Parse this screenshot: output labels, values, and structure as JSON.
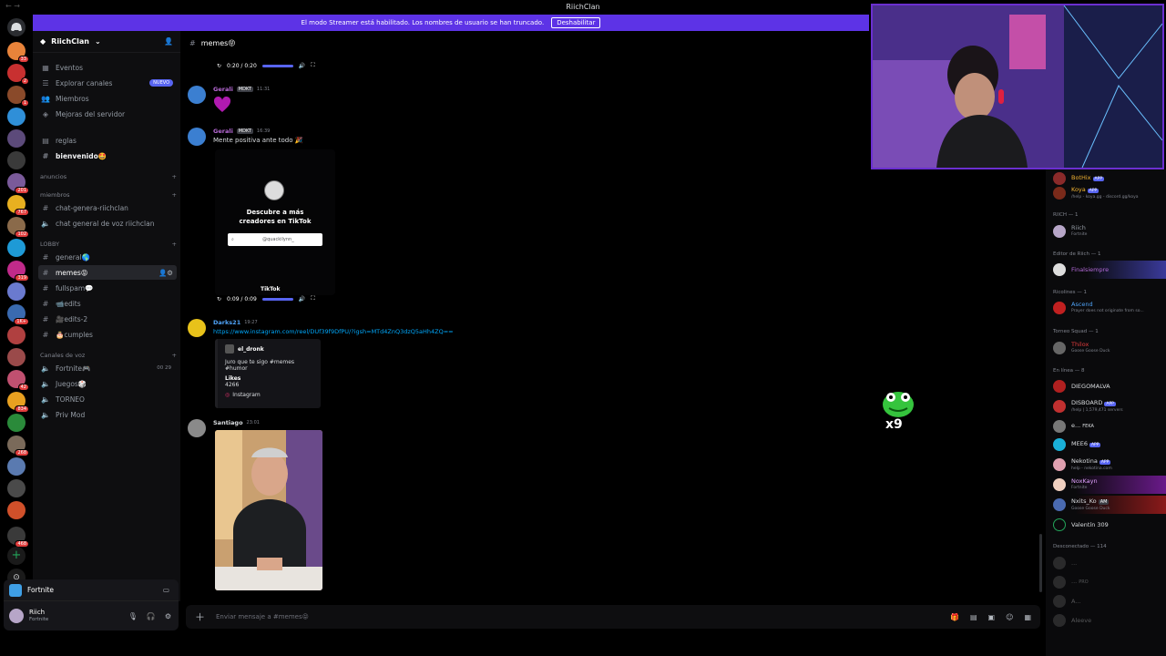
{
  "window": {
    "title": "RiichClan"
  },
  "banner": {
    "text": "El modo Streamer está habilitado. Los nombres de usuario se han truncado.",
    "button": "Deshabilitar"
  },
  "guild_badges": [
    "33",
    "2",
    "1",
    "201",
    "767",
    "102",
    "319",
    "1K+",
    "42",
    "834",
    "268",
    "468"
  ],
  "server": {
    "name": "RiichClan"
  },
  "nav": {
    "eventos": "Eventos",
    "explorar": "Explorar canales",
    "nuevo": "NUEVO",
    "miembros": "Miembros",
    "mejoras": "Mejoras del servidor"
  },
  "channels": {
    "reglas": "reglas",
    "bienvenido": "bienvenido🤩",
    "cat_anuncios": "anuncios",
    "cat_miembros": "miembros",
    "chat_genera": "chat-genera-riichclan",
    "chat_voz": "chat general de voz riichclan",
    "cat_lobby": "LOBBY",
    "general": "general🌎",
    "memes": "memes😝",
    "fullspam": "fullspam💬",
    "edits": "📹edits",
    "edits2": "🎥edits-2",
    "cumples": "🎂cumples",
    "cat_voz": "Canales de voz",
    "fortnite": "Fortnite🎮",
    "fortnite_count": "00  29",
    "juegos": "Juegos🎲",
    "torneo": "TORNEO",
    "priv": "Priv Mod"
  },
  "voice_panel": {
    "channel": "Fortnite"
  },
  "user": {
    "name": "Riich",
    "status": "Fortnite"
  },
  "chat": {
    "channel": "memes😝",
    "player1": {
      "time": "0:20 / 0:20"
    },
    "msg1": {
      "name": "Gerali",
      "badge": "MDKT",
      "time": "11:31"
    },
    "msg2": {
      "name": "Gerali",
      "badge": "MDKT",
      "time": "16:39",
      "text": "Mente positiva  ante todo 🎉"
    },
    "tiktok": {
      "title1": "Descubre a más",
      "title2": "creadores en TikTok",
      "search": "@quackilynn_",
      "logo": "TikTok"
    },
    "player2": {
      "time": "0:09 / 0:09"
    },
    "msg3": {
      "name": "Darks21",
      "time": "19:27",
      "link": "https://www.instagram.com/reel/DUf39f9DfPU/?igsh=MTd4ZnQ3dzQ5aHh4ZQ=="
    },
    "embed": {
      "author": "el_dronk",
      "text": "Juro que te sigo #memes #humor",
      "likes_label": "Likes",
      "likes": "4266",
      "provider": "Instagram"
    },
    "msg4": {
      "name": "Santiago",
      "time": "23:01"
    }
  },
  "composer": {
    "placeholder": "Enviar mensaje a #memes😝"
  },
  "sticker": {
    "count": "x9"
  },
  "members": {
    "bot1": {
      "name": "BotHix",
      "tag": "APP"
    },
    "koya": {
      "name": "Koya",
      "tag": "APP",
      "sub": "/help - koya.gg - discord.gg/koya"
    },
    "g_riich": "RIICH — 1",
    "riich": {
      "name": "Riich",
      "sub": "Fortnite"
    },
    "g_editor": "Editor de Riich — 1",
    "editor": {
      "name": "Finalsiempre"
    },
    "g_ricolines": "Ricolines — 1",
    "ascend": {
      "name": "Ascend",
      "sub": "Prayer does not originate from so..."
    },
    "g_torneo": "Torneo Squad — 1",
    "thilox": {
      "name": "Thilox",
      "sub": "Goose Goose Duck"
    },
    "g_online": "En línea — 8",
    "diego": {
      "name": "DIEGOMALVA"
    },
    "disboard": {
      "name": "DISBOARD",
      "tag": "APP",
      "sub": "/help | 1,579,471 servers"
    },
    "e": {
      "name": "e...",
      "sub": "FEKA"
    },
    "mee6": {
      "name": "MEE6",
      "tag": "APP"
    },
    "nekotina": {
      "name": "Nekotina",
      "tag": "APP",
      "sub": "help - nekotina.com"
    },
    "noxkayn": {
      "name": "NoxKayn",
      "sub": "Fortnite"
    },
    "nxits": {
      "name": "Nxits_Ko",
      "badge": "AM",
      "sub": "Goose Goose Duck"
    },
    "valentin": {
      "name": "Valentín 309"
    },
    "g_offline": "Desconectado — 114",
    "off1": {
      "name": "..."
    },
    "off2": {
      "name": "...",
      "sub": "PRO"
    },
    "off3": {
      "name": "A..."
    },
    "off4": {
      "name": "Aleeve"
    }
  }
}
